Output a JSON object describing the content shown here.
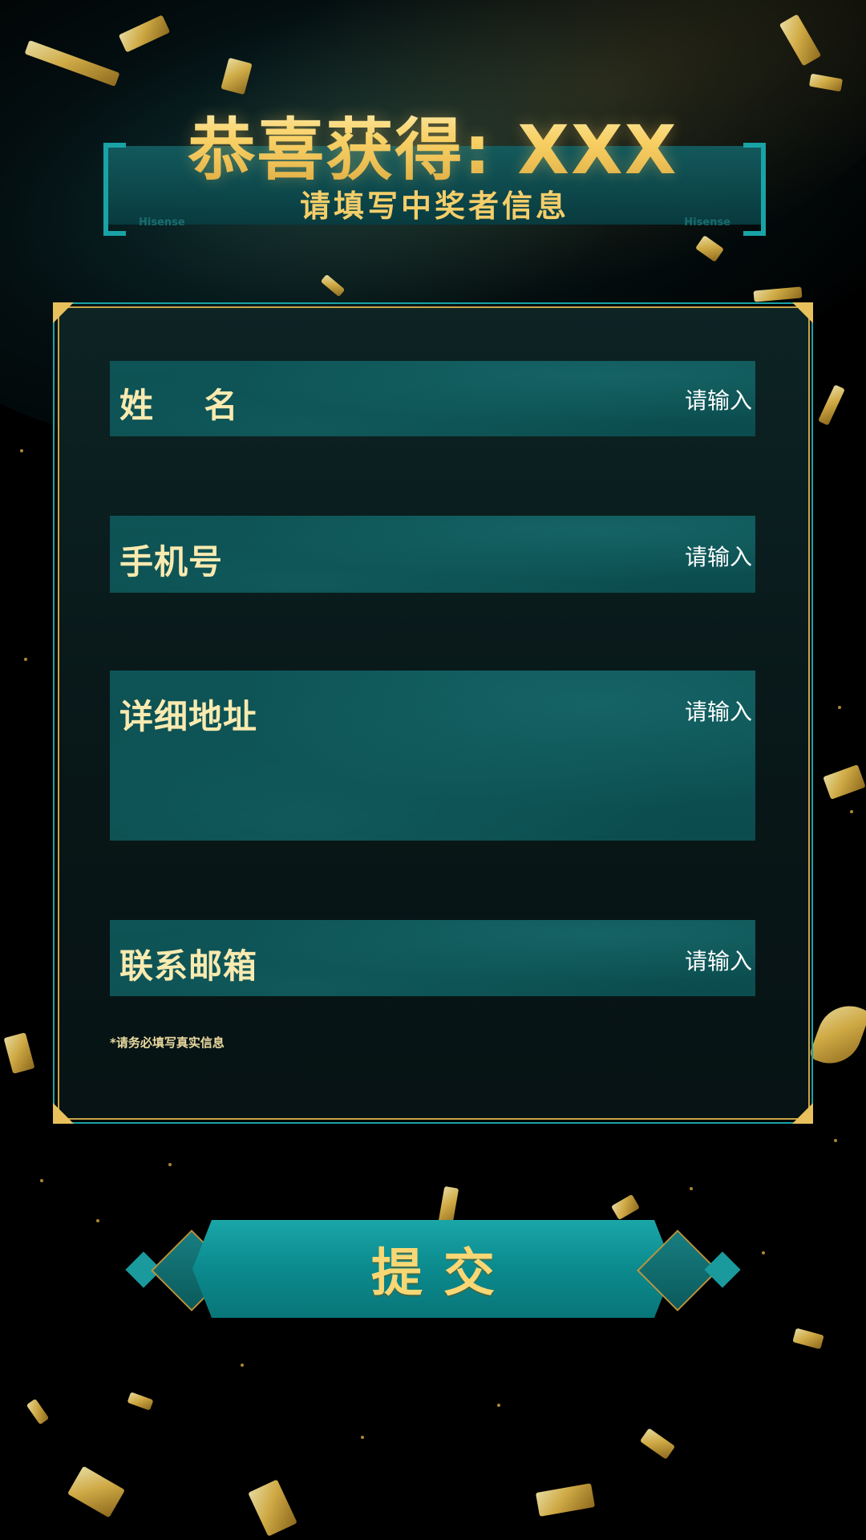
{
  "header": {
    "title": "恭喜获得: XXX",
    "subtitle": "请填写中奖者信息",
    "brand_mark": "Hisense"
  },
  "form": {
    "fields": [
      {
        "label": "姓    名",
        "placeholder": "请输入"
      },
      {
        "label": "手机号",
        "placeholder": "请输入"
      },
      {
        "label": "详细地址",
        "placeholder": "请输入"
      },
      {
        "label": "联系邮箱",
        "placeholder": "请输入"
      }
    ],
    "note": "*请务必填写真实信息",
    "submit_label": "提交"
  },
  "colors": {
    "background": "#000000",
    "field_bg": "#0e5456",
    "accent_teal": "#1aa4a6",
    "gold": "#e8c15c",
    "label_text": "#f9eab0"
  }
}
